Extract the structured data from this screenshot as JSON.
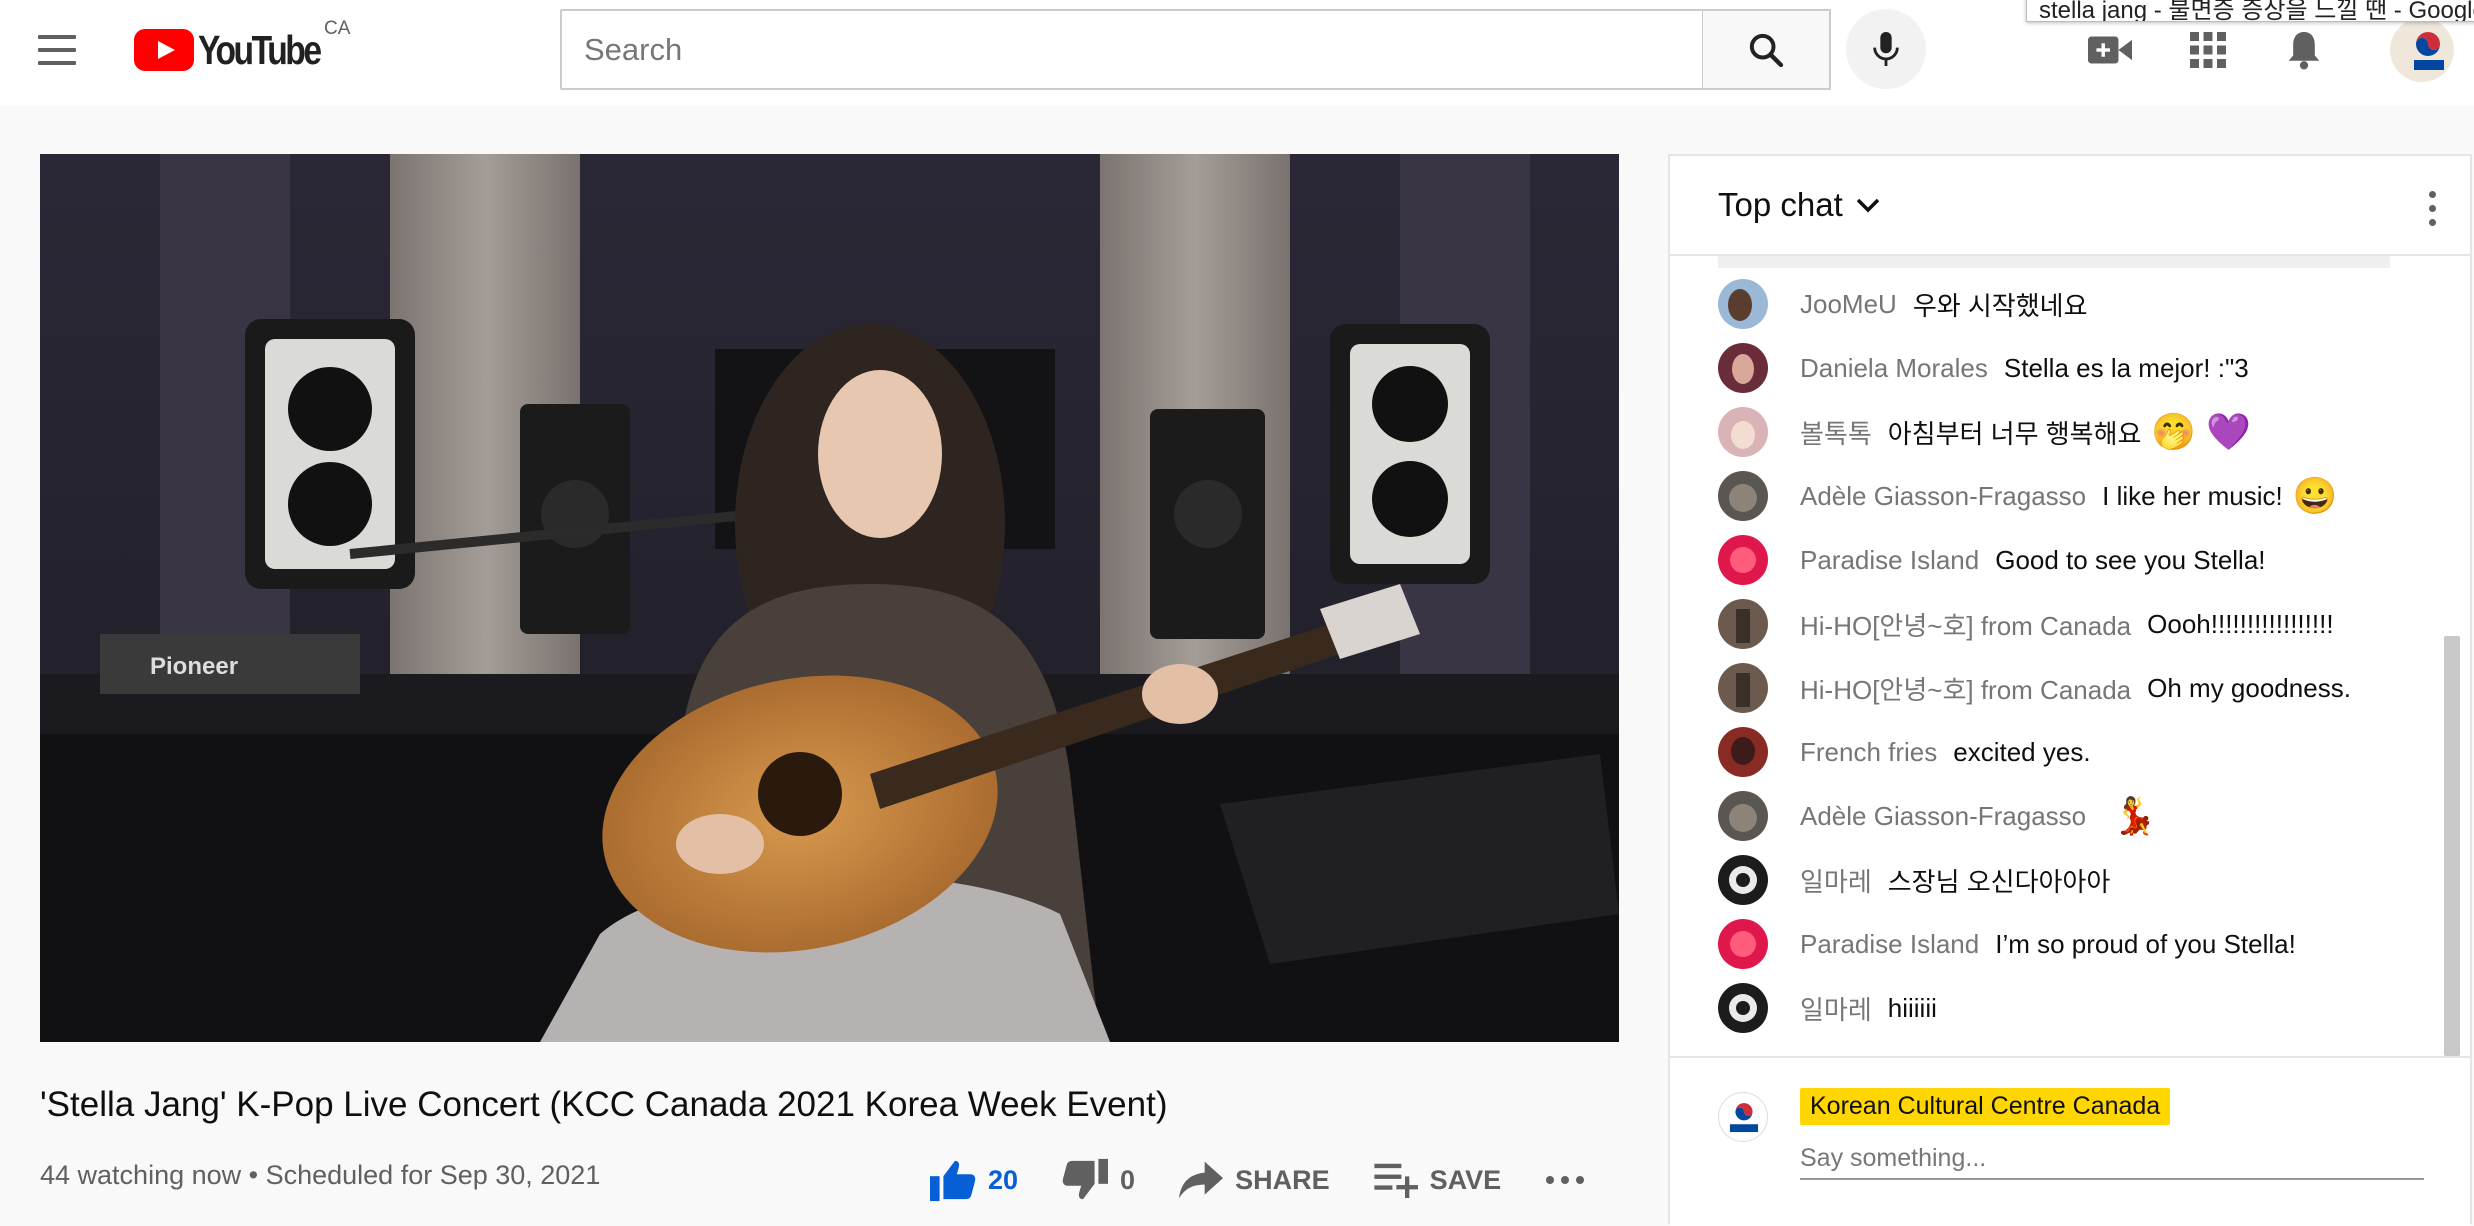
{
  "header": {
    "logo_text": "YouTube",
    "country": "CA",
    "search_placeholder": "Search",
    "tooltip": "stella jang - 불면증 증상을 느낄 땐 - Google S"
  },
  "video": {
    "title": "'Stella Jang' K-Pop Live Concert (KCC Canada 2021 Korea Week Event)",
    "meta": "44 watching now • Scheduled for Sep 30, 2021",
    "likes": "20",
    "dislikes": "0",
    "share_label": "SHARE",
    "save_label": "SAVE"
  },
  "chat": {
    "title": "Top chat",
    "messages": [
      {
        "author": "JooMeU",
        "text": "우와 시작했네요",
        "emoji": "",
        "avatar_color": "#9bb8d6"
      },
      {
        "author": "Daniela Morales",
        "text": "Stella es la mejor! :\"3",
        "emoji": "",
        "avatar_color": "#6b2c3a"
      },
      {
        "author": "볼톡톡",
        "text": "아침부터 너무 행복해요",
        "emoji": "🤭 💜",
        "avatar_color": "#d9b3b6"
      },
      {
        "author": "Adèle Giasson-Fragasso",
        "text": "I like her music!",
        "emoji": "😀",
        "avatar_color": "#5a5652"
      },
      {
        "author": "Paradise Island",
        "text": "Good to see you Stella!",
        "emoji": "",
        "avatar_color": "#e0174b"
      },
      {
        "author": "Hi-HO[안녕~호] from Canada",
        "text": "Oooh!!!!!!!!!!!!!!!!!",
        "emoji": "",
        "avatar_color": "#6d5a4e"
      },
      {
        "author": "Hi-HO[안녕~호] from Canada",
        "text": "Oh my goodness.",
        "emoji": "",
        "avatar_color": "#6d5a4e"
      },
      {
        "author": "French fries",
        "text": "excited yes.",
        "emoji": "",
        "avatar_color": "#8a2a24"
      },
      {
        "author": "Adèle Giasson-Fragasso",
        "text": "",
        "emoji": "💃",
        "avatar_color": "#5a5652"
      },
      {
        "author": "일마레",
        "text": "스장님 오신다아아아",
        "emoji": "",
        "avatar_color": "#1c1c1c"
      },
      {
        "author": "Paradise Island",
        "text": "I’m so proud of you Stella!",
        "emoji": "",
        "avatar_color": "#e0174b"
      },
      {
        "author": "일마레",
        "text": "hiiiiii",
        "emoji": "",
        "avatar_color": "#1c1c1c"
      }
    ],
    "me_name": "Korean Cultural Centre Canada",
    "input_placeholder": "Say something..."
  },
  "colors": {
    "accent": "#065fd4",
    "brand_red": "#ff0000",
    "highlight": "#ffd600"
  }
}
